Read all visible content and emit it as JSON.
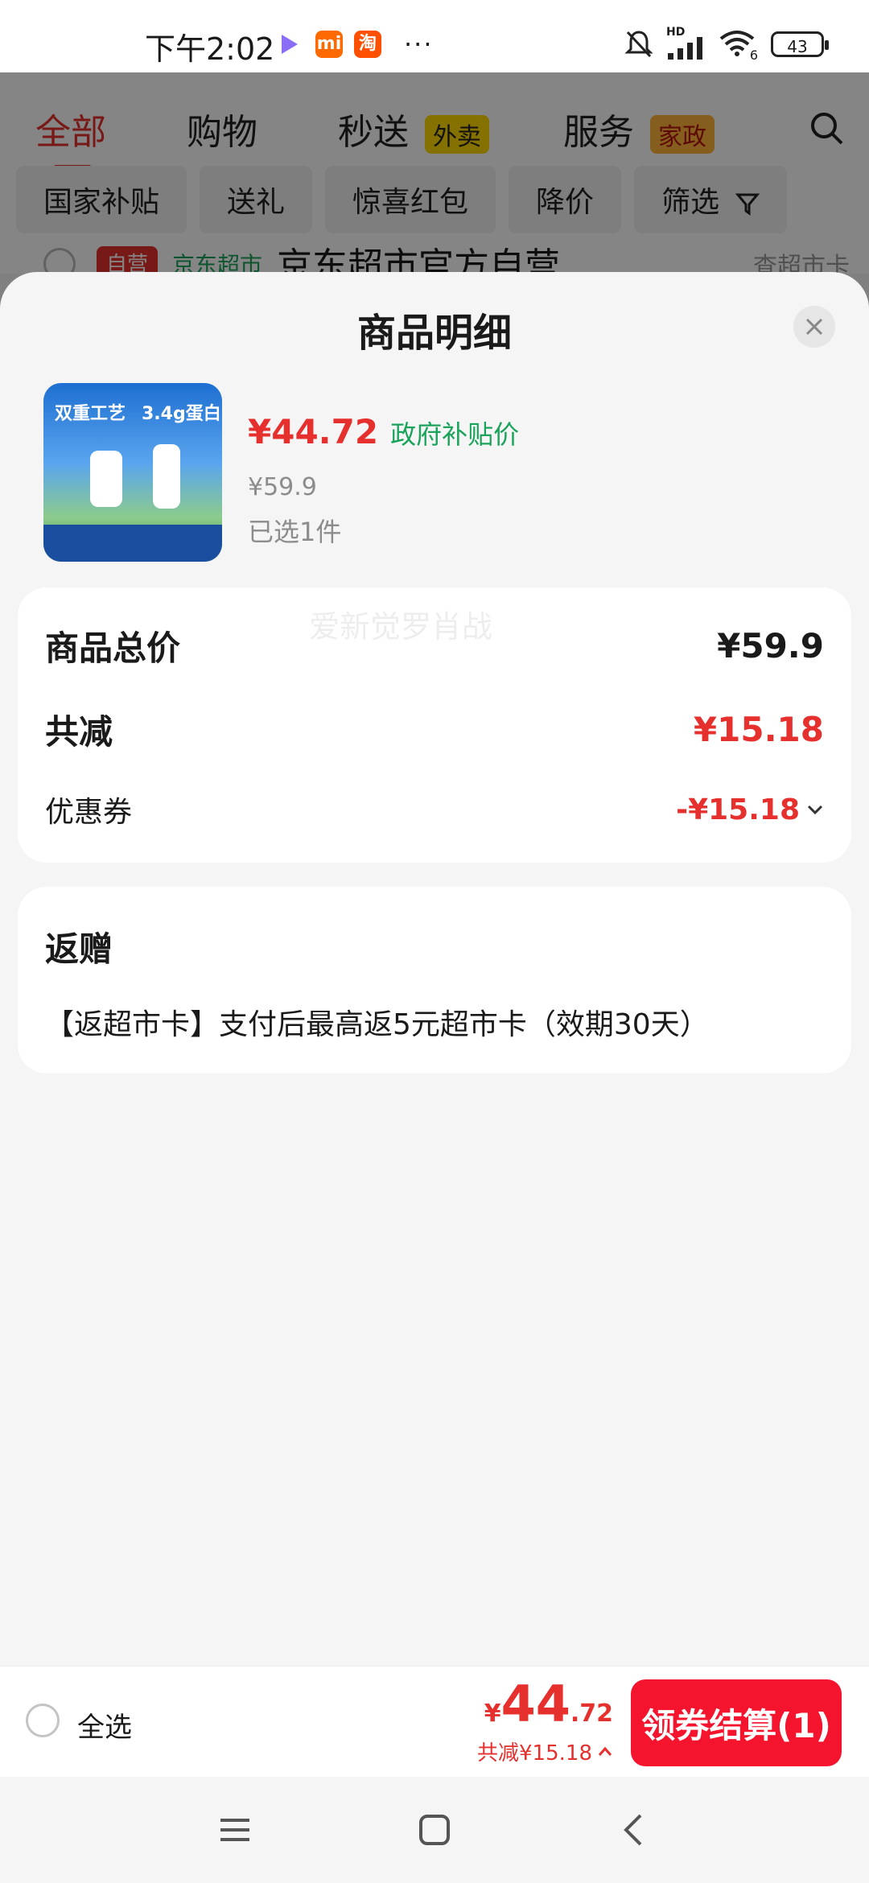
{
  "status_bar": {
    "time": "下午2:02",
    "app_icons": [
      "play-icon",
      "xiaomi-icon",
      "taobao-icon"
    ],
    "xiaomi_label": "mi",
    "taobao_label": "淘",
    "more": "···",
    "network": "HD",
    "wifi_label": "6",
    "battery": "43"
  },
  "background_page": {
    "tabs": [
      {
        "label": "全部"
      },
      {
        "label": "购物"
      },
      {
        "label": "秒送",
        "badge": "外卖"
      },
      {
        "label": "服务",
        "badge": "家政"
      }
    ],
    "chips": [
      "国家补贴",
      "送礼",
      "惊喜红包",
      "降价",
      "筛选"
    ],
    "store": {
      "badge": "自营",
      "channel": "京东超市",
      "name": "京东超市官方自营",
      "link": "查超市卡"
    }
  },
  "sheet": {
    "title": "商品明细",
    "product": {
      "image_text_1": "双重工艺",
      "image_text_2": "3.4g蛋白",
      "price": "¥44.72",
      "price_tag": "政府补贴价",
      "original_price": "¥59.9",
      "selected": "已选1件"
    },
    "summary": {
      "total_label": "商品总价",
      "total_value": "¥59.9",
      "discount_label": "共减",
      "discount_value": "¥15.18",
      "coupon_label": "优惠券",
      "coupon_value": "-¥15.18"
    },
    "gift": {
      "title": "返赠",
      "text": "【返超市卡】支付后最高返5元超市卡（效期30天）"
    },
    "watermark": "爱新觉罗肖战"
  },
  "bottom_bar": {
    "select_all": "全选",
    "currency": "¥",
    "price_int": "44",
    "price_dec": ".72",
    "discount": "共减¥15.18",
    "checkout": "领券结算(1)"
  },
  "colors": {
    "accent_red": "#e5302d",
    "button_red": "#f5142e",
    "green": "#1aa35a"
  }
}
